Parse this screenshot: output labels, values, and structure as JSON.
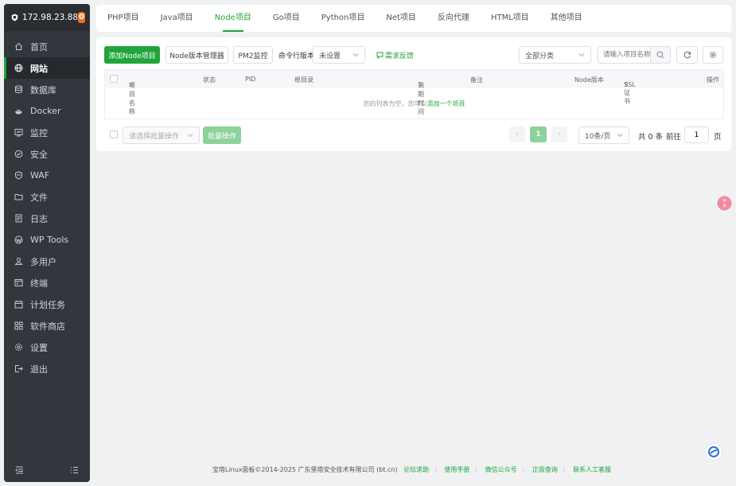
{
  "sidebar": {
    "ip": "172.98.23.88",
    "badge": "0",
    "items": [
      {
        "label": "首页",
        "icon": "home-icon"
      },
      {
        "label": "网站",
        "icon": "globe-icon"
      },
      {
        "label": "数据库",
        "icon": "database-icon"
      },
      {
        "label": "Docker",
        "icon": "docker-icon"
      },
      {
        "label": "监控",
        "icon": "monitor-icon"
      },
      {
        "label": "安全",
        "icon": "shield-icon"
      },
      {
        "label": "WAF",
        "icon": "waf-shield-icon"
      },
      {
        "label": "文件",
        "icon": "folder-icon"
      },
      {
        "label": "日志",
        "icon": "log-icon"
      },
      {
        "label": "WP Tools",
        "icon": "wordpress-icon"
      },
      {
        "label": "多用户",
        "icon": "users-icon"
      },
      {
        "label": "终端",
        "icon": "terminal-icon"
      },
      {
        "label": "计划任务",
        "icon": "calendar-icon"
      },
      {
        "label": "软件商店",
        "icon": "apps-icon"
      },
      {
        "label": "设置",
        "icon": "gear-icon"
      },
      {
        "label": "退出",
        "icon": "logout-icon"
      }
    ]
  },
  "tabs": [
    "PHP项目",
    "Java项目",
    "Node项目",
    "Go项目",
    "Python项目",
    "Net项目",
    "反向代理",
    "HTML项目",
    "其他项目"
  ],
  "toolbar": {
    "add": "添加Node项目",
    "version_mgr": "Node版本管理器",
    "pm2": "PM2监控",
    "cmd_label": "命令行版本",
    "cmd_value": "未设置",
    "feedback": "需求反馈",
    "category": "全部分类",
    "search_placeholder": "请输入项目名称"
  },
  "table": {
    "headers": [
      "项目名称",
      "状态",
      "PID",
      "根目录",
      "到期时间",
      "备注",
      "Node版本",
      "SSL证书",
      "操作"
    ],
    "empty_text": "您的列表为空，您可以",
    "empty_link": "添加一个项目"
  },
  "batch": {
    "placeholder": "请选择批量操作",
    "button": "批量操作"
  },
  "pagination": {
    "current": "1",
    "per_page": "10条/页",
    "total": "共 0 条",
    "goto": "前往",
    "page_input": "1",
    "page_suffix": "页"
  },
  "footer": {
    "copyright": "宝塔Linux面板©2014-2025 广东堡塔安全技术有限公司 (bt.cn)",
    "links": [
      "论坛求助",
      "使用手册",
      "微信公众号",
      "正版查询",
      "联系人工客服"
    ]
  },
  "colors": {
    "accent": "#20a53a",
    "sidebar": "#32373d",
    "badge": "#f0711e"
  }
}
